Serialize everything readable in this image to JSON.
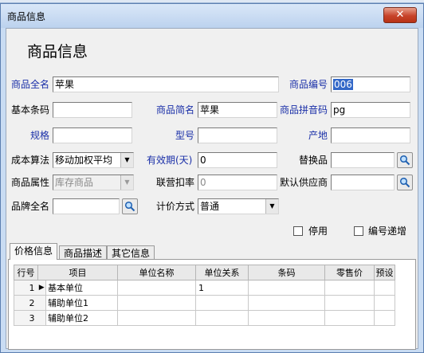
{
  "window": {
    "title": "商品信息",
    "close_symbol": "✕"
  },
  "form": {
    "heading": "商品信息",
    "full_name": {
      "label": "商品全名",
      "value": "苹果"
    },
    "code": {
      "label": "商品编号",
      "value": "006"
    },
    "barcode": {
      "label": "基本条码",
      "value": ""
    },
    "short_name": {
      "label": "商品简名",
      "value": "苹果"
    },
    "pinyin_code": {
      "label": "商品拼音码",
      "value": "pg"
    },
    "spec": {
      "label": "规格",
      "value": ""
    },
    "model": {
      "label": "型号",
      "value": ""
    },
    "origin": {
      "label": "产地",
      "value": ""
    },
    "cost_method": {
      "label": "成本算法",
      "value": "移动加权平均"
    },
    "expiry": {
      "label": "有效期(天)",
      "value": "0"
    },
    "substitute": {
      "label": "替换品",
      "value": ""
    },
    "attribute": {
      "label": "商品属性",
      "value": "库存商品"
    },
    "joint_discount": {
      "label": "联营扣率",
      "value": "0"
    },
    "default_supplier": {
      "label": "默认供应商",
      "value": ""
    },
    "brand": {
      "label": "品牌全名",
      "value": ""
    },
    "pricing_method": {
      "label": "计价方式",
      "value": "普通"
    },
    "disabled": {
      "label": "停用",
      "checked": false
    },
    "auto_increment": {
      "label": "编号递增",
      "checked": false
    }
  },
  "tabs": [
    {
      "label": "价格信息",
      "active": true
    },
    {
      "label": "商品描述",
      "active": false
    },
    {
      "label": "其它信息",
      "active": false
    }
  ],
  "units_table": {
    "headers": [
      "行号",
      "项目",
      "单位名称",
      "单位关系",
      "条码",
      "零售价",
      "预设"
    ],
    "rows": [
      {
        "row_no": "1",
        "item": "基本单位",
        "unit_name": "",
        "relation": "1",
        "barcode": "",
        "retail_price": "",
        "preset": ""
      },
      {
        "row_no": "2",
        "item": "辅助单位1",
        "unit_name": "",
        "relation": "",
        "barcode": "",
        "retail_price": "",
        "preset": ""
      },
      {
        "row_no": "3",
        "item": "辅助单位2",
        "unit_name": "",
        "relation": "",
        "barcode": "",
        "retail_price": "",
        "preset": ""
      }
    ],
    "current_row_marker": "▶"
  },
  "icons": {
    "search": "search-icon",
    "dropdown": "chevron-down-icon"
  },
  "colors": {
    "label_blue": "#1a2fa8",
    "selection": "#3368c8",
    "close_red": "#c7432a"
  }
}
